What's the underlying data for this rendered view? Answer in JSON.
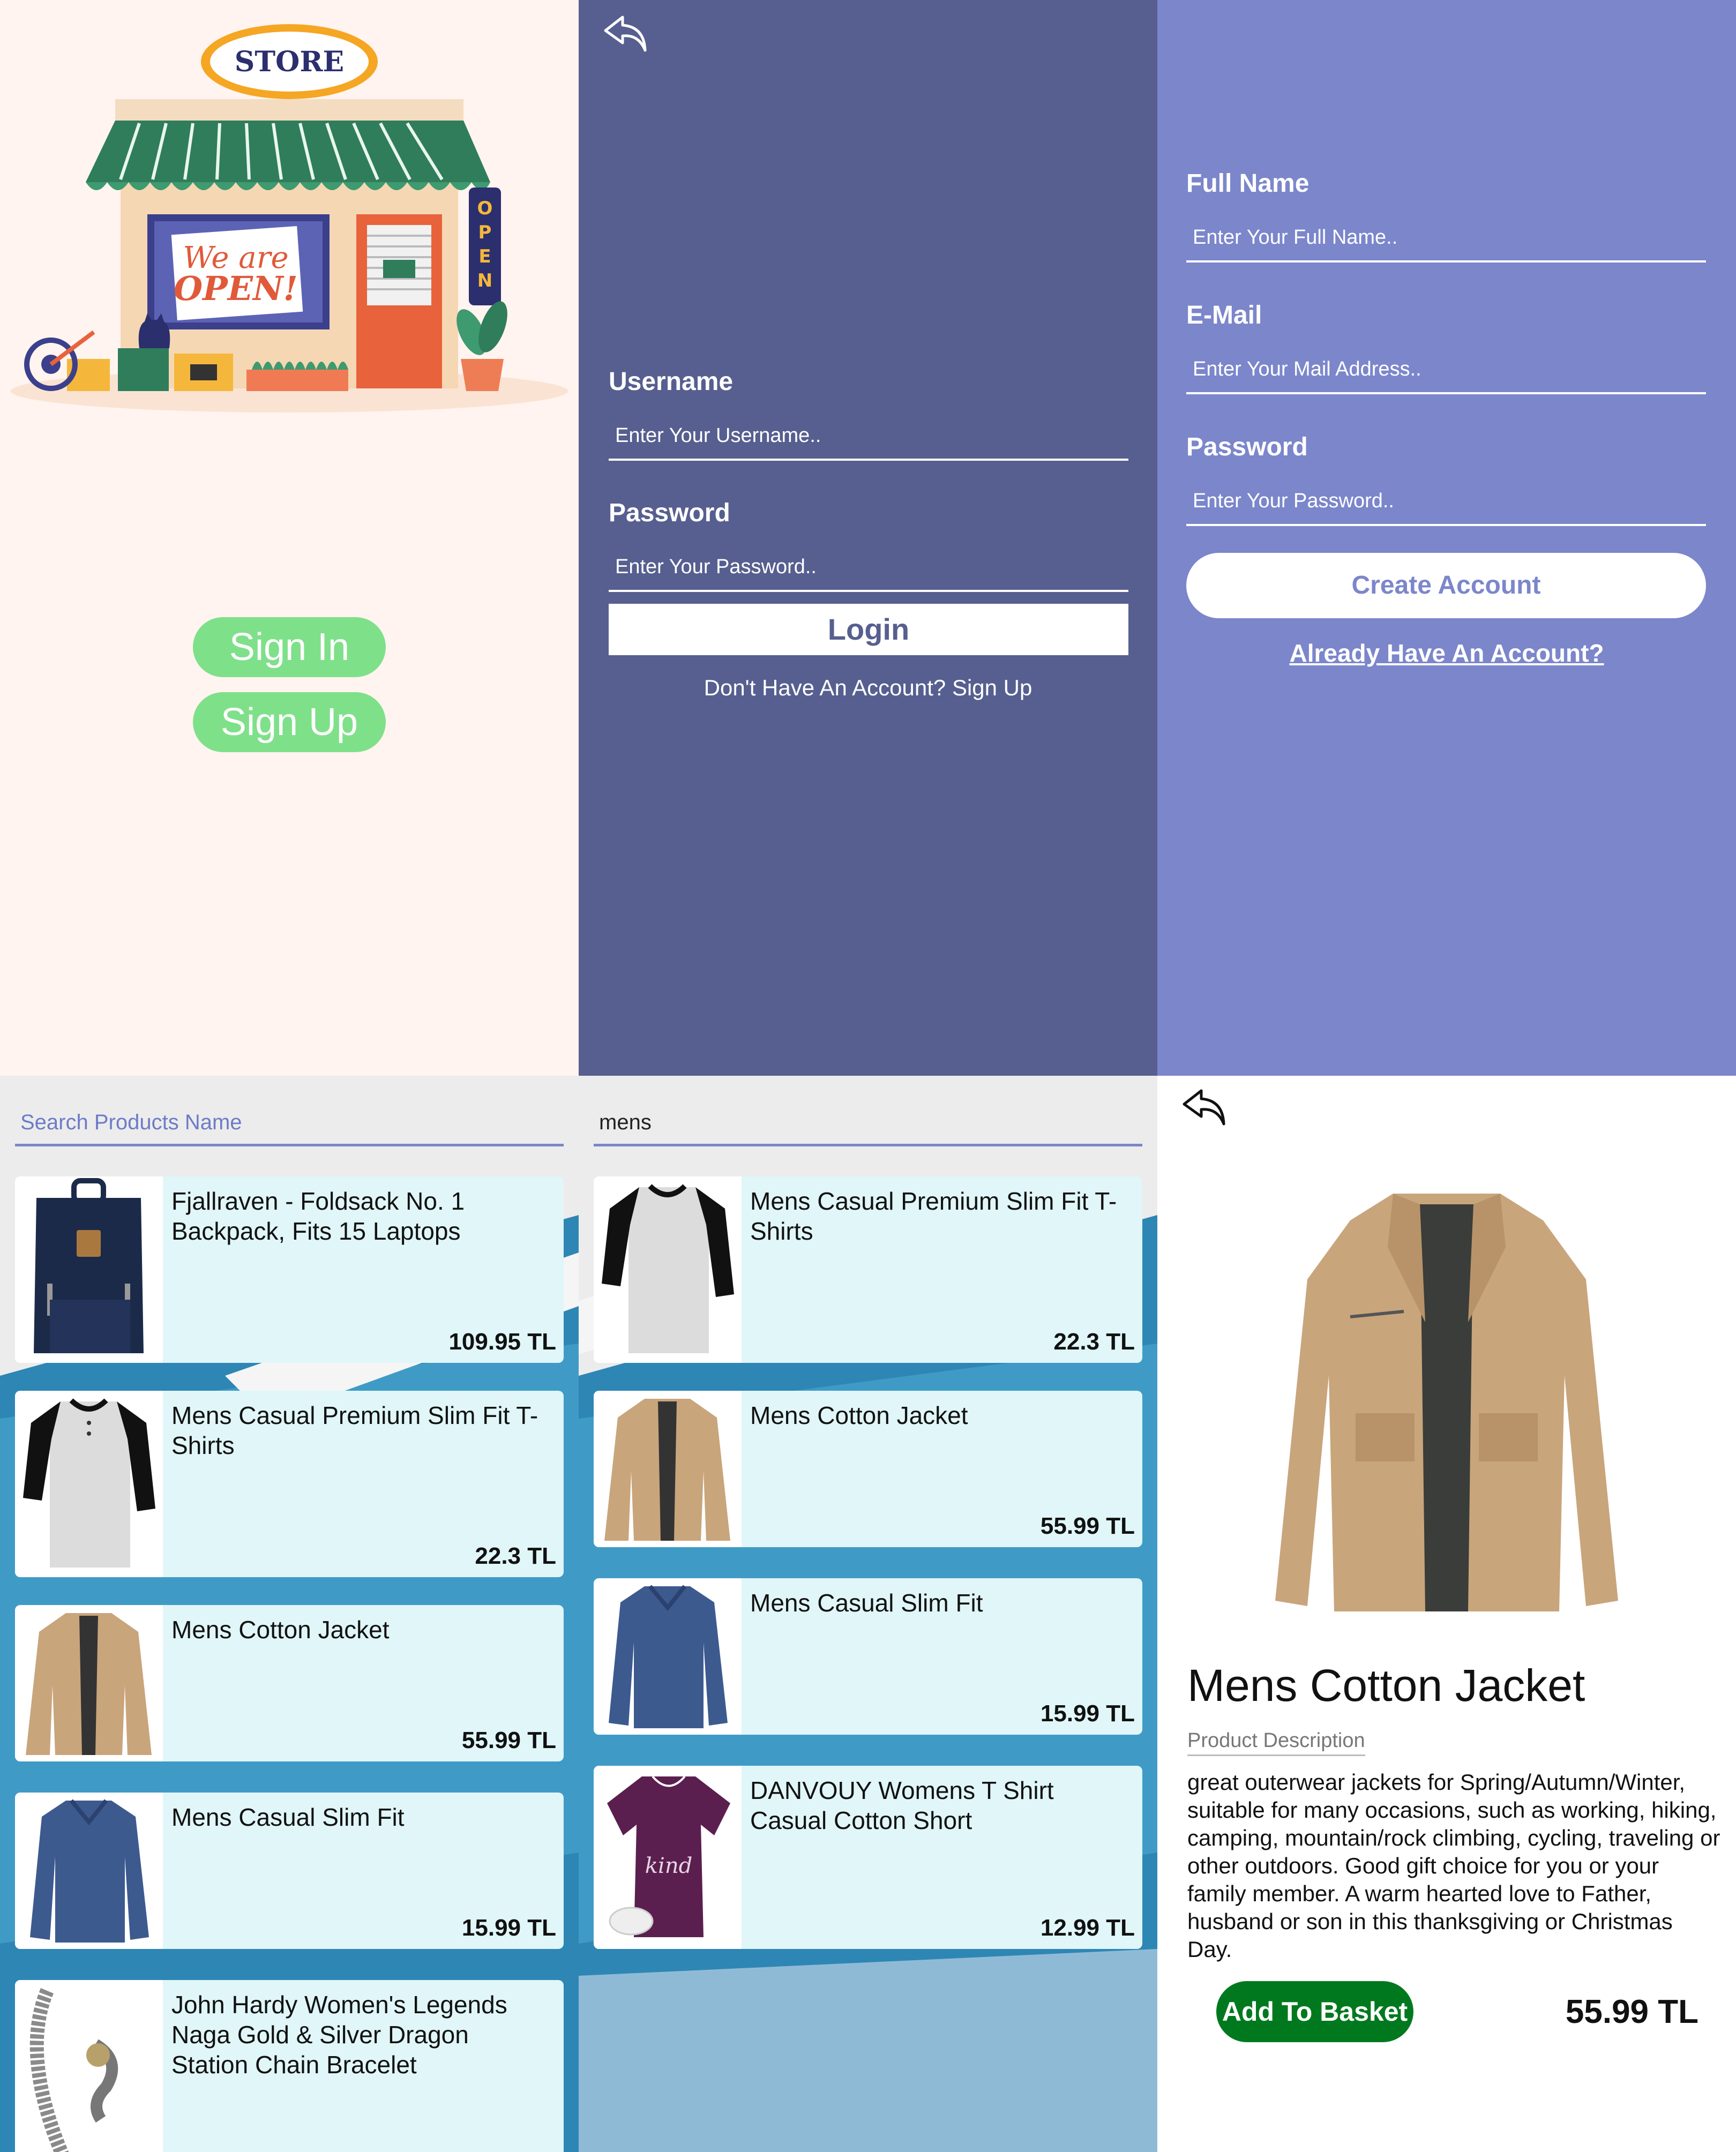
{
  "colors": {
    "store_bg": "#fff4ef",
    "login_bg": "#565f8f",
    "signup_bg": "#7b86cb",
    "pill_green": "#7fe08a",
    "card_bg": "#e0f6f8",
    "basket_green": "#00791e"
  },
  "welcome": {
    "store_sign": "STORE",
    "window_sign_line1": "We are",
    "window_sign_line2": "OPEN!",
    "door_sign": "OPEN",
    "signin_label": "Sign In",
    "signup_label": "Sign Up"
  },
  "login": {
    "back_icon": "back-arrow-icon",
    "username_label": "Username",
    "username_placeholder": "Enter Your Username..",
    "password_label": "Password",
    "password_placeholder": "Enter Your Password..",
    "login_label": "Login",
    "signup_link": "Don't Have An Account? Sign Up"
  },
  "register": {
    "fullname_label": "Full Name",
    "fullname_placeholder": "Enter Your Full Name..",
    "email_label": "E-Mail",
    "email_placeholder": "Enter Your Mail Address..",
    "password_label": "Password",
    "password_placeholder": "Enter Your Password..",
    "create_label": "Create Account",
    "login_link": "Already Have An Account?"
  },
  "product_list": {
    "search_placeholder": "Search Products Name",
    "items": [
      {
        "title": "Fjallraven - Foldsack No. 1 Backpack, Fits 15 Laptops",
        "price": "109.95 TL",
        "thumb": "backpack"
      },
      {
        "title": "Mens Casual Premium Slim Fit T-Shirts",
        "price": "22.3 TL",
        "thumb": "raglan-shirt"
      },
      {
        "title": "Mens Cotton Jacket",
        "price": "55.99 TL",
        "thumb": "jacket"
      },
      {
        "title": "Mens Casual Slim Fit",
        "price": "15.99 TL",
        "thumb": "blue-shirt"
      },
      {
        "title": "John Hardy Women's Legends Naga Gold & Silver Dragon Station Chain Bracelet",
        "price": "",
        "thumb": "bracelet"
      }
    ]
  },
  "search_results": {
    "query": "mens",
    "items": [
      {
        "title": "Mens Casual Premium Slim Fit T-Shirts",
        "price": "22.3 TL",
        "thumb": "raglan-shirt"
      },
      {
        "title": "Mens Cotton Jacket",
        "price": "55.99 TL",
        "thumb": "jacket"
      },
      {
        "title": "Mens Casual Slim Fit",
        "price": "15.99 TL",
        "thumb": "blue-shirt"
      },
      {
        "title": "DANVOUY Womens T Shirt Casual Cotton Short",
        "price": "12.99 TL",
        "thumb": "purple-shirt"
      }
    ]
  },
  "detail": {
    "back_icon": "back-arrow-icon",
    "title": "Mens Cotton Jacket",
    "description_label": "Product Description",
    "description": "great outerwear jackets for Spring/Autumn/Winter, suitable for many occasions, such as working, hiking, camping, mountain/rock climbing, cycling, traveling or other outdoors. Good gift choice for you or your family member. A warm hearted love to Father, husband or son in this thanksgiving or Christmas Day.",
    "basket_label": "Add To Basket",
    "price": "55.99 TL"
  }
}
